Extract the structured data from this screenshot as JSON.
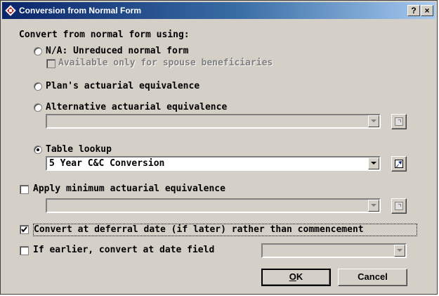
{
  "window": {
    "title": "Conversion from Normal Form",
    "help_label": "?",
    "close_label": "×"
  },
  "group": {
    "label": "Convert from normal form using:"
  },
  "options": {
    "unreduced": "N/A: Unreduced normal form",
    "spouse_only": "Available only for spouse beneficiaries",
    "plan_equiv": "Plan's actuarial equivalence",
    "alt_equiv": "Alternative actuarial equivalence",
    "table_lookup": "Table lookup",
    "table_value": "5 Year C&C Conversion",
    "apply_min": "Apply minimum actuarial equivalence",
    "defer_convert": "Convert at deferral date (if later) rather than commencement",
    "earlier_convert": "If earlier, convert at date field"
  },
  "state": {
    "selected_option": "table_lookup",
    "defer_convert_checked": true,
    "apply_min_checked": false,
    "earlier_convert_checked": false,
    "spouse_only_checked": false
  },
  "buttons": {
    "ok": "OK",
    "cancel": "Cancel"
  }
}
